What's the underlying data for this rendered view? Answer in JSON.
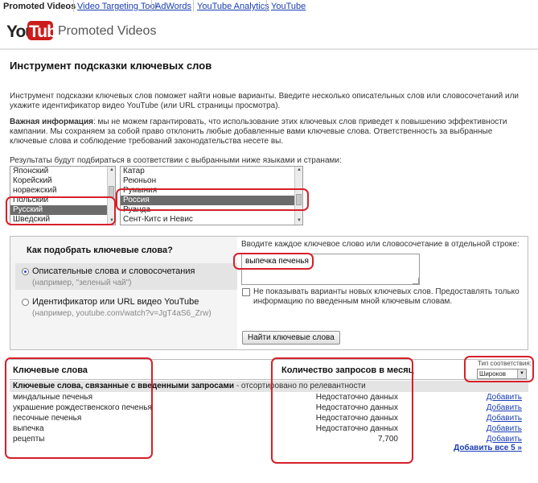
{
  "topnav": {
    "current": "Promoted Videos",
    "links": [
      "Video Targeting Tool",
      "AdWords",
      "YouTube Analytics",
      "YouTube"
    ]
  },
  "logo": {
    "you": "You",
    "tube": "Tube",
    "product": "Promoted Videos"
  },
  "page": {
    "title": "Инструмент подсказки ключевых слов",
    "intro": "Инструмент подсказки ключевых слов поможет найти новые варианты. Введите несколько описательных слов или словосочетаний или укажите идентификатор видео YouTube (или URL страницы просмотра).",
    "important_label": "Важная информация",
    "important_text": ": мы не можем гарантировать, что использование этих ключевых слов приведет к повышению эффективности кампании. Мы сохраняем за собой право отклонить любые добавленные вами ключевые слова. Ответственность за выбранные ключевые слова и соблюдение требований законодательства несете вы.",
    "results_note": "Результаты будут подбираться в соответствии с выбранными ниже языками и странами:"
  },
  "languages": {
    "options": [
      "Японский",
      "Корейский",
      "норвежский",
      "Польский",
      "Русский",
      "Шведский"
    ],
    "selected": "Русский"
  },
  "countries": {
    "options": [
      "Катар",
      "Реюньон",
      "Румыния",
      "Россия",
      "Руанда",
      "Сент-Китс и Невис"
    ],
    "selected": "Россия"
  },
  "panel": {
    "question": "Как подобрать ключевые слова?",
    "option1_title": "Описательные слова и словосочетания",
    "option1_hint": "(например, \"зеленый чай\")",
    "option2_title": "Идентификатор или URL видео YouTube",
    "option2_hint": "(например, youtube.com/watch?v=JgT4aS6_Zrw)",
    "instruction": "Вводите каждое ключевое слово или словосочетание в отдельной строке:",
    "textarea_value": "выпечка печенья",
    "checkbox_label": "Не показывать варианты новых ключевых слов. Предоставлять только информацию по введенным мной ключевым словам.",
    "find_button": "Найти ключевые слова"
  },
  "results": {
    "col_keywords": "Ключевые слова",
    "col_volume": "Количество запросов в месяц",
    "match_type_label": "Тип соответствия:",
    "match_type_value": "Широков",
    "group_title": "Ключевые слова, связанные с введенными запросами",
    "group_sort": " - отсортировано по релевантности",
    "rows": [
      {
        "keyword": "миндальные печенья",
        "volume": "Недостаточно данных",
        "action": "Добавить"
      },
      {
        "keyword": "украшение рождественского печенья",
        "volume": "Недостаточно данных",
        "action": "Добавить"
      },
      {
        "keyword": "песочные печенья",
        "volume": "Недостаточно данных",
        "action": "Добавить"
      },
      {
        "keyword": "выпечка",
        "volume": "Недостаточно данных",
        "action": "Добавить"
      },
      {
        "keyword": "рецепты",
        "volume": "7,700",
        "action": "Добавить"
      }
    ],
    "add_all": "Добавить все 5 »"
  },
  "colors": {
    "link": "#1a3db8",
    "highlight_outline": "#d6202a",
    "logo_red": "#cc1b1b",
    "selected_row": "#6b6b6b"
  }
}
